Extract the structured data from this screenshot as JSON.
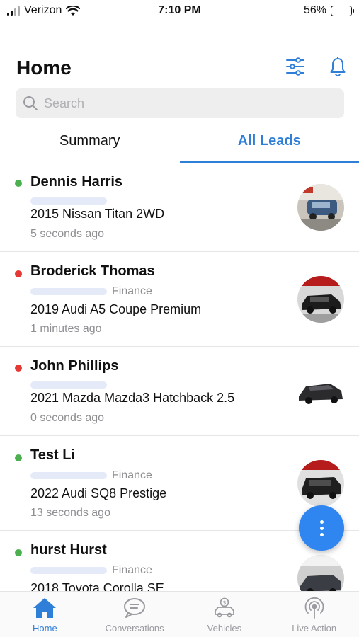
{
  "status_bar": {
    "carrier": "Verizon",
    "time": "7:10 PM",
    "battery": "56%",
    "battery_level": 0.56
  },
  "header": {
    "title": "Home",
    "filter_icon": "sliders-icon",
    "bell_icon": "bell-icon"
  },
  "search": {
    "placeholder": "Search",
    "value": ""
  },
  "tabs": [
    {
      "label": "Summary",
      "active": false
    },
    {
      "label": "All Leads",
      "active": true
    }
  ],
  "colors": {
    "accent": "#2f7fd9",
    "online": "#4caf50",
    "offline": "#e53935",
    "fab": "#2f86f0"
  },
  "leads": [
    {
      "name": "Dennis Harris",
      "tag": "",
      "vehicle": "2015 Nissan Titan 2WD",
      "time": "5 seconds ago",
      "status": "online"
    },
    {
      "name": "Broderick Thomas",
      "tag": "Finance",
      "vehicle": "2019 Audi A5 Coupe Premium",
      "time": "1 minutes ago",
      "status": "offline"
    },
    {
      "name": "John Phillips",
      "tag": "",
      "vehicle": "2021 Mazda Mazda3 Hatchback 2.5",
      "time": "0 seconds ago",
      "status": "offline"
    },
    {
      "name": "Test Li",
      "tag": "Finance",
      "vehicle": "2022 Audi SQ8 Prestige",
      "time": "13 seconds ago",
      "status": "online"
    },
    {
      "name": "hurst Hurst",
      "tag": "Finance",
      "vehicle": "2018 Toyota Corolla SE",
      "time": "",
      "status": "online"
    }
  ],
  "tabbar": [
    {
      "label": "Home",
      "icon": "home-icon",
      "active": true
    },
    {
      "label": "Conversations",
      "icon": "chat-icon",
      "active": false
    },
    {
      "label": "Vehicles",
      "icon": "car-dollar-icon",
      "active": false
    },
    {
      "label": "Live Action",
      "icon": "broadcast-icon",
      "active": false
    }
  ]
}
